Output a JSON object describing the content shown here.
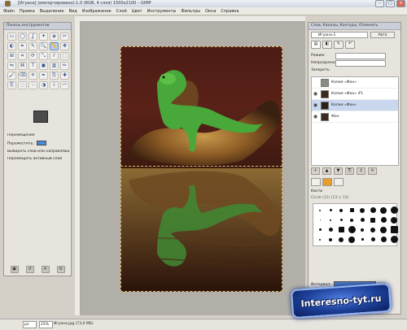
{
  "window": {
    "title": "[Игуана] (импортировано)-1.0 (RGB, 4 слоя) 1500x2100 – GIMP",
    "controls": [
      "–",
      "□",
      "×"
    ]
  },
  "menubar": [
    "Файл",
    "Правка",
    "Выделение",
    "Вид",
    "Изображение",
    "Слой",
    "Цвет",
    "Инструменты",
    "Фильтры",
    "Окна",
    "Справка"
  ],
  "toolbox": {
    "title": "Панель инструментов",
    "tools": [
      "rect-select",
      "ellipse-select",
      "lasso",
      "fuzzy-select",
      "color-select",
      "scissors",
      "foreground-select",
      "paths",
      "color-picker",
      "zoom",
      "measure",
      "move",
      "align",
      "crop",
      "rotate",
      "scale",
      "shear",
      "perspective",
      "flip",
      "cage",
      "text",
      "bucket-fill",
      "blend",
      "pencil",
      "paintbrush",
      "eraser",
      "airbrush",
      "ink",
      "clone",
      "heal",
      "perspective-clone",
      "blur",
      "smudge",
      "dodge",
      "iscissors",
      "warp"
    ],
    "selected_tool": 10,
    "options": {
      "title": "Перемещение",
      "mode_label": "Переместить:",
      "mode_icons": [
        "layer-icon",
        "selection-icon",
        "path-icon"
      ],
      "option1": "Выбирать слой или направляющую",
      "option2": "Перемещать активный слой"
    },
    "fg_color": "#4b4b4b",
    "bg_color": "#ffffff"
  },
  "dock": {
    "title": "Слои, Каналы, Контуры, Отменить",
    "image_selector": "Игуана-1",
    "auto_button": "Авто",
    "mode_label": "Режим:",
    "mode_value": "Нормальный",
    "opacity_label": "Непрозрачность:",
    "lock_label": "Запереть:",
    "layers": [
      {
        "name": "Копия «Фон»",
        "thumb": "#8d8a84",
        "visible": false,
        "selected": false
      },
      {
        "name": "Копия «Фон» #1",
        "thumb": "#3a2a1e",
        "visible": true,
        "selected": false
      },
      {
        "name": "Копия «Фон»",
        "thumb": "#2b2118",
        "visible": true,
        "selected": true
      },
      {
        "name": "Фон",
        "thumb": "#3b2a1f",
        "visible": true,
        "selected": false
      }
    ],
    "brushes_title": "Кисти",
    "brush_name": "Circle (11) (13 × 13)",
    "spacing_label": "Интервал:",
    "spacing_value": "10.0"
  },
  "status": {
    "unit": "px",
    "zoom": "25%",
    "message": "Игуана.jpg (73,0 МБ)"
  },
  "watermark": "Interesno-tyt.ru"
}
